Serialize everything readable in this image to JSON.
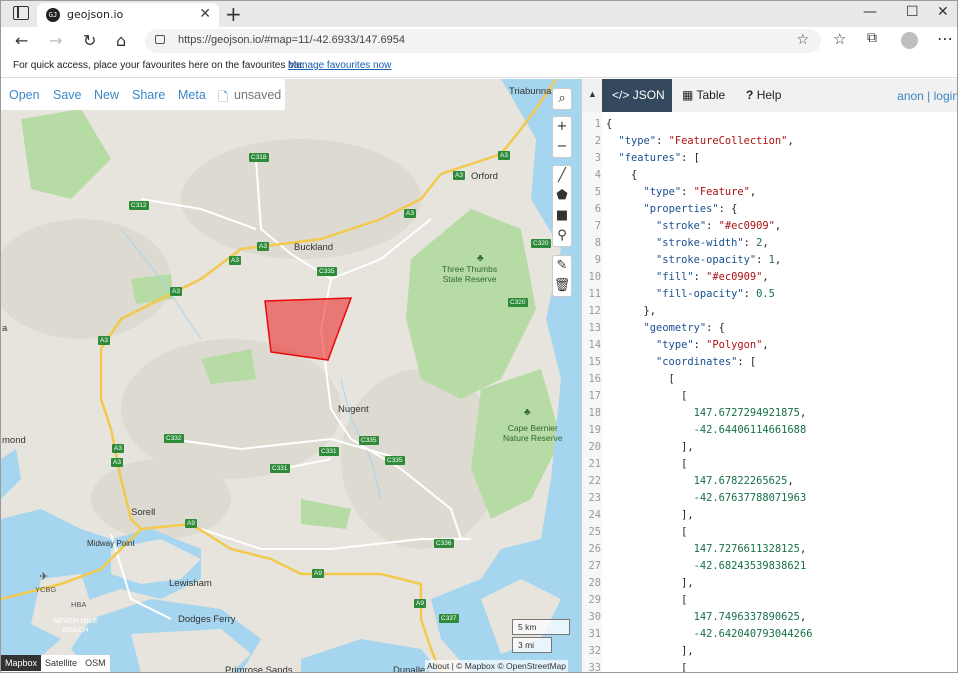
{
  "browser": {
    "tab_title": "geojson.io",
    "favicon_text": "GJ",
    "url": "https://geojson.io/#map=11/-42.6933/147.6954",
    "favourites_text": "For quick access, place your favourites here on the favourites bar.",
    "favourites_link": "Manage favourites now"
  },
  "app_menu": {
    "open": "Open",
    "save": "Save",
    "new": "New",
    "share": "Share",
    "meta": "Meta",
    "unsaved": "unsaved"
  },
  "map": {
    "places": {
      "triabunna": "Triabunna",
      "orford": "Orford",
      "buckland": "Buckland",
      "nugent": "Nugent",
      "sorell": "Sorell",
      "midway_point": "Midway Point",
      "lewisham": "Lewisham",
      "dodges_ferry": "Dodges Ferry",
      "primrose_sands": "Primrose Sands",
      "richmond_partial": "mond",
      "left_edge_partial": "a",
      "dunalley_partial": "Dunalley"
    },
    "parks": {
      "three_thumbs": "Three Thumbs\nState Reserve",
      "cape_bernier": "Cape Bernier\nNature Reserve"
    },
    "airport": {
      "code": "YCBG",
      "hba": "HBA",
      "beach": "SEVEN MILE\nBEACH"
    },
    "roads": {
      "c318": "C318",
      "a3_top": "A3",
      "c312": "C312",
      "a3_buckland": "A3",
      "a3_b": "A3",
      "c335_top": "C335",
      "a3_c": "A3",
      "c320_a": "C320",
      "c320_b": "C320",
      "a3_d": "A3",
      "a3_e": "A3",
      "c332": "C332",
      "c335_mid": "C335",
      "c331": "C331",
      "c335_low": "C335",
      "a3_f": "A3",
      "c331_b": "C331",
      "a9_sorell": "A9",
      "c336": "C336",
      "a9_mid": "A9",
      "a9_low": "A9",
      "c337": "C337",
      "a3_left": "A3",
      "a3_orford": "A3"
    },
    "scale": {
      "km": "5 km",
      "mi": "3 mi"
    },
    "attribution": "About | © Mapbox © OpenStreetMap",
    "layers": [
      "Mapbox",
      "Satellite",
      "OSM"
    ],
    "active_layer": "Mapbox",
    "polygon": {
      "fill": "#ec0909",
      "fill_opacity": 0.5,
      "coordinates": [
        [
          147.6727294921875,
          -42.64406114661688
        ],
        [
          147.67822265625,
          -42.67637788071963
        ],
        [
          147.7276611328125,
          -42.68243539838621
        ],
        [
          147.7496337890625,
          -42.642040793044266
        ]
      ]
    },
    "controls": [
      "zoom-in",
      "zoom-out",
      "draw-line",
      "draw-polygon",
      "draw-rectangle",
      "draw-marker",
      "edit",
      "delete"
    ]
  },
  "panel": {
    "tabs": {
      "json": "JSON",
      "table": "Table",
      "help": "Help"
    },
    "auth": "anon | login",
    "code_lines": [
      {
        "t": [
          [
            "p",
            "{"
          ]
        ]
      },
      {
        "t": [
          [
            "p",
            "  "
          ],
          [
            "k",
            "\"type\""
          ],
          [
            "p",
            ": "
          ],
          [
            "s",
            "\"FeatureCollection\""
          ],
          [
            "p",
            ","
          ]
        ]
      },
      {
        "t": [
          [
            "p",
            "  "
          ],
          [
            "k",
            "\"features\""
          ],
          [
            "p",
            ": ["
          ]
        ]
      },
      {
        "t": [
          [
            "p",
            "    {"
          ]
        ]
      },
      {
        "t": [
          [
            "p",
            "      "
          ],
          [
            "k",
            "\"type\""
          ],
          [
            "p",
            ": "
          ],
          [
            "s",
            "\"Feature\""
          ],
          [
            "p",
            ","
          ]
        ]
      },
      {
        "t": [
          [
            "p",
            "      "
          ],
          [
            "k",
            "\"properties\""
          ],
          [
            "p",
            ": {"
          ]
        ]
      },
      {
        "t": [
          [
            "p",
            "        "
          ],
          [
            "k",
            "\"stroke\""
          ],
          [
            "p",
            ": "
          ],
          [
            "s",
            "\"#ec0909\""
          ],
          [
            "p",
            ","
          ]
        ]
      },
      {
        "t": [
          [
            "p",
            "        "
          ],
          [
            "k",
            "\"stroke-width\""
          ],
          [
            "p",
            ": "
          ],
          [
            "n",
            "2"
          ],
          [
            "p",
            ","
          ]
        ]
      },
      {
        "t": [
          [
            "p",
            "        "
          ],
          [
            "k",
            "\"stroke-opacity\""
          ],
          [
            "p",
            ": "
          ],
          [
            "n",
            "1"
          ],
          [
            "p",
            ","
          ]
        ]
      },
      {
        "t": [
          [
            "p",
            "        "
          ],
          [
            "k",
            "\"fill\""
          ],
          [
            "p",
            ": "
          ],
          [
            "s",
            "\"#ec0909\""
          ],
          [
            "p",
            ","
          ]
        ]
      },
      {
        "t": [
          [
            "p",
            "        "
          ],
          [
            "k",
            "\"fill-opacity\""
          ],
          [
            "p",
            ": "
          ],
          [
            "n",
            "0.5"
          ]
        ]
      },
      {
        "t": [
          [
            "p",
            "      },"
          ]
        ]
      },
      {
        "t": [
          [
            "p",
            "      "
          ],
          [
            "k",
            "\"geometry\""
          ],
          [
            "p",
            ": {"
          ]
        ]
      },
      {
        "t": [
          [
            "p",
            "        "
          ],
          [
            "k",
            "\"type\""
          ],
          [
            "p",
            ": "
          ],
          [
            "s",
            "\"Polygon\""
          ],
          [
            "p",
            ","
          ]
        ]
      },
      {
        "t": [
          [
            "p",
            "        "
          ],
          [
            "k",
            "\"coordinates\""
          ],
          [
            "p",
            ": ["
          ]
        ]
      },
      {
        "t": [
          [
            "p",
            "          ["
          ]
        ]
      },
      {
        "t": [
          [
            "p",
            "            ["
          ]
        ]
      },
      {
        "t": [
          [
            "p",
            "              "
          ],
          [
            "n",
            "147.6727294921875"
          ],
          [
            "p",
            ","
          ]
        ]
      },
      {
        "t": [
          [
            "p",
            "              "
          ],
          [
            "n",
            "-42.64406114661688"
          ]
        ]
      },
      {
        "t": [
          [
            "p",
            "            ],"
          ]
        ]
      },
      {
        "t": [
          [
            "p",
            "            ["
          ]
        ]
      },
      {
        "t": [
          [
            "p",
            "              "
          ],
          [
            "n",
            "147.67822265625"
          ],
          [
            "p",
            ","
          ]
        ]
      },
      {
        "t": [
          [
            "p",
            "              "
          ],
          [
            "n",
            "-42.67637788071963"
          ]
        ]
      },
      {
        "t": [
          [
            "p",
            "            ],"
          ]
        ]
      },
      {
        "t": [
          [
            "p",
            "            ["
          ]
        ]
      },
      {
        "t": [
          [
            "p",
            "              "
          ],
          [
            "n",
            "147.7276611328125"
          ],
          [
            "p",
            ","
          ]
        ]
      },
      {
        "t": [
          [
            "p",
            "              "
          ],
          [
            "n",
            "-42.68243539838621"
          ]
        ]
      },
      {
        "t": [
          [
            "p",
            "            ],"
          ]
        ]
      },
      {
        "t": [
          [
            "p",
            "            ["
          ]
        ]
      },
      {
        "t": [
          [
            "p",
            "              "
          ],
          [
            "n",
            "147.7496337890625"
          ],
          [
            "p",
            ","
          ]
        ]
      },
      {
        "t": [
          [
            "p",
            "              "
          ],
          [
            "n",
            "-42.642040793044266"
          ]
        ]
      },
      {
        "t": [
          [
            "p",
            "            ],"
          ]
        ]
      },
      {
        "t": [
          [
            "p",
            "            ["
          ]
        ]
      }
    ]
  },
  "colors": {
    "accent": "#3b87c5",
    "tab_active": "#34495e",
    "polygon": "#ec0909",
    "water": "#a6d6ef",
    "park": "#b7dba4",
    "land": "#e6e4dd",
    "road_highway": "#f2c94c"
  }
}
